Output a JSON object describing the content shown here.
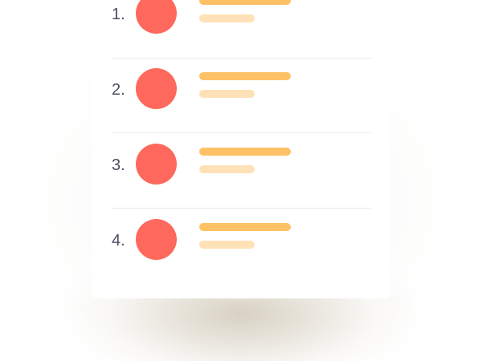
{
  "list": {
    "items": [
      {
        "number": "1."
      },
      {
        "number": "2."
      },
      {
        "number": "3."
      },
      {
        "number": "4."
      }
    ]
  },
  "colors": {
    "avatar": "#ff685c",
    "primary_bar": "#ffc166",
    "secondary_bar": "#ffe1b7",
    "number_text": "#4a5060",
    "divider": "#eceae7"
  }
}
